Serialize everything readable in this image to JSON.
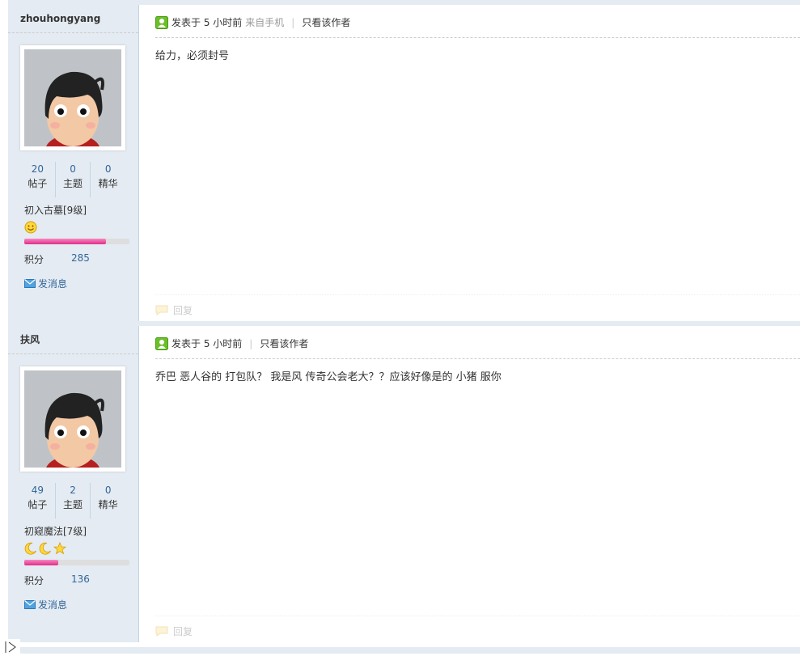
{
  "posts": [
    {
      "username": "zhouhongyang",
      "stats": [
        {
          "num": "20",
          "label": "帖子"
        },
        {
          "num": "0",
          "label": "主题"
        },
        {
          "num": "0",
          "label": "精华"
        }
      ],
      "rank": "初入古墓[9级]",
      "rank_icons": [
        "smiley-icon"
      ],
      "progress": 0.78,
      "credit_label": "积分",
      "credit_value": "285",
      "message_label": "发消息",
      "post_time": "发表于 5 小时前",
      "from": "来自手机",
      "only_author": "只看该作者",
      "content": "给力，必须封号",
      "reply_label": "回复"
    },
    {
      "username": "扶风",
      "stats": [
        {
          "num": "49",
          "label": "帖子"
        },
        {
          "num": "2",
          "label": "主题"
        },
        {
          "num": "0",
          "label": "精华"
        }
      ],
      "rank": "初窥魔法[7级]",
      "rank_icons": [
        "moon-icon",
        "moon-icon",
        "star-icon"
      ],
      "progress": 0.32,
      "credit_label": "积分",
      "credit_value": "136",
      "message_label": "发消息",
      "post_time": "发表于 5 小时前",
      "from": "",
      "only_author": "只看该作者",
      "content": "乔巴 恶人谷的 打包队？ 我是风  传奇公会老大？？应该好像是的  小猪 服你",
      "reply_label": "回复"
    }
  ],
  "colors": {
    "sidebar_bg": "#e4ebf2",
    "link": "#336699",
    "progress": "#e02c8a"
  }
}
